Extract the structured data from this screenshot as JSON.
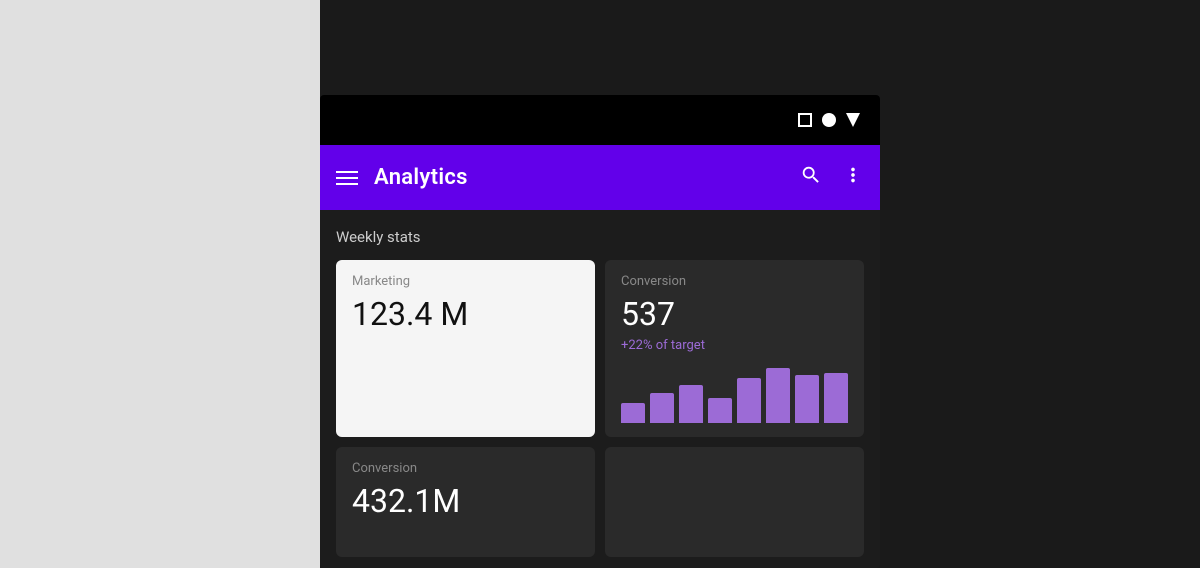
{
  "layout": {
    "left_panel_color": "#e0e0e0",
    "right_panel_color": "#1a1a1a"
  },
  "status_bar": {
    "icons": [
      "square",
      "circle",
      "triangle"
    ]
  },
  "app_bar": {
    "title": "Analytics",
    "search_label": "Search",
    "more_label": "More options",
    "menu_label": "Menu"
  },
  "content": {
    "weekly_stats_label": "Weekly stats",
    "cards": [
      {
        "id": "marketing",
        "label": "Marketing",
        "value": "123.4 M",
        "theme": "light"
      },
      {
        "id": "conversion-top",
        "label": "Conversion",
        "value": "537",
        "subtitle": "+22% of target",
        "theme": "dark"
      }
    ],
    "cards_row2": [
      {
        "id": "conversion-bottom",
        "label": "Conversion",
        "value": "432.1M",
        "theme": "dark"
      }
    ],
    "bar_chart": {
      "bars": [
        {
          "height": 20
        },
        {
          "height": 30
        },
        {
          "height": 38
        },
        {
          "height": 25
        },
        {
          "height": 45
        },
        {
          "height": 55
        },
        {
          "height": 48
        },
        {
          "height": 50
        }
      ]
    }
  }
}
